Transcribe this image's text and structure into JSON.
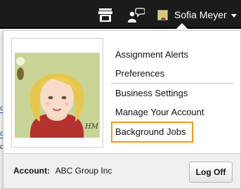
{
  "topbar": {
    "user_name": "Sofia Meyer",
    "icons": [
      "store-icon",
      "people-chat-icon",
      "avatar-icon",
      "caret-down-icon"
    ]
  },
  "profile_photo": {
    "name": "profile-photo",
    "signature_mark": "H"
  },
  "menu": {
    "items": [
      {
        "label": "Assignment Alerts"
      },
      {
        "label": "Preferences"
      },
      {
        "label": "Business Settings"
      },
      {
        "label": "Manage Your Account"
      },
      {
        "label": "Background Jobs"
      }
    ]
  },
  "footer": {
    "account_label": "Account:",
    "account_name": "ABC Group Inc",
    "logoff_label": "Log Off"
  },
  "background_fragments": [
    "d",
    "d",
    "d"
  ],
  "colors": {
    "topbar_bg": "#1b1b1b",
    "highlight": "#f39c12",
    "photo_bg": "#c9d597"
  }
}
